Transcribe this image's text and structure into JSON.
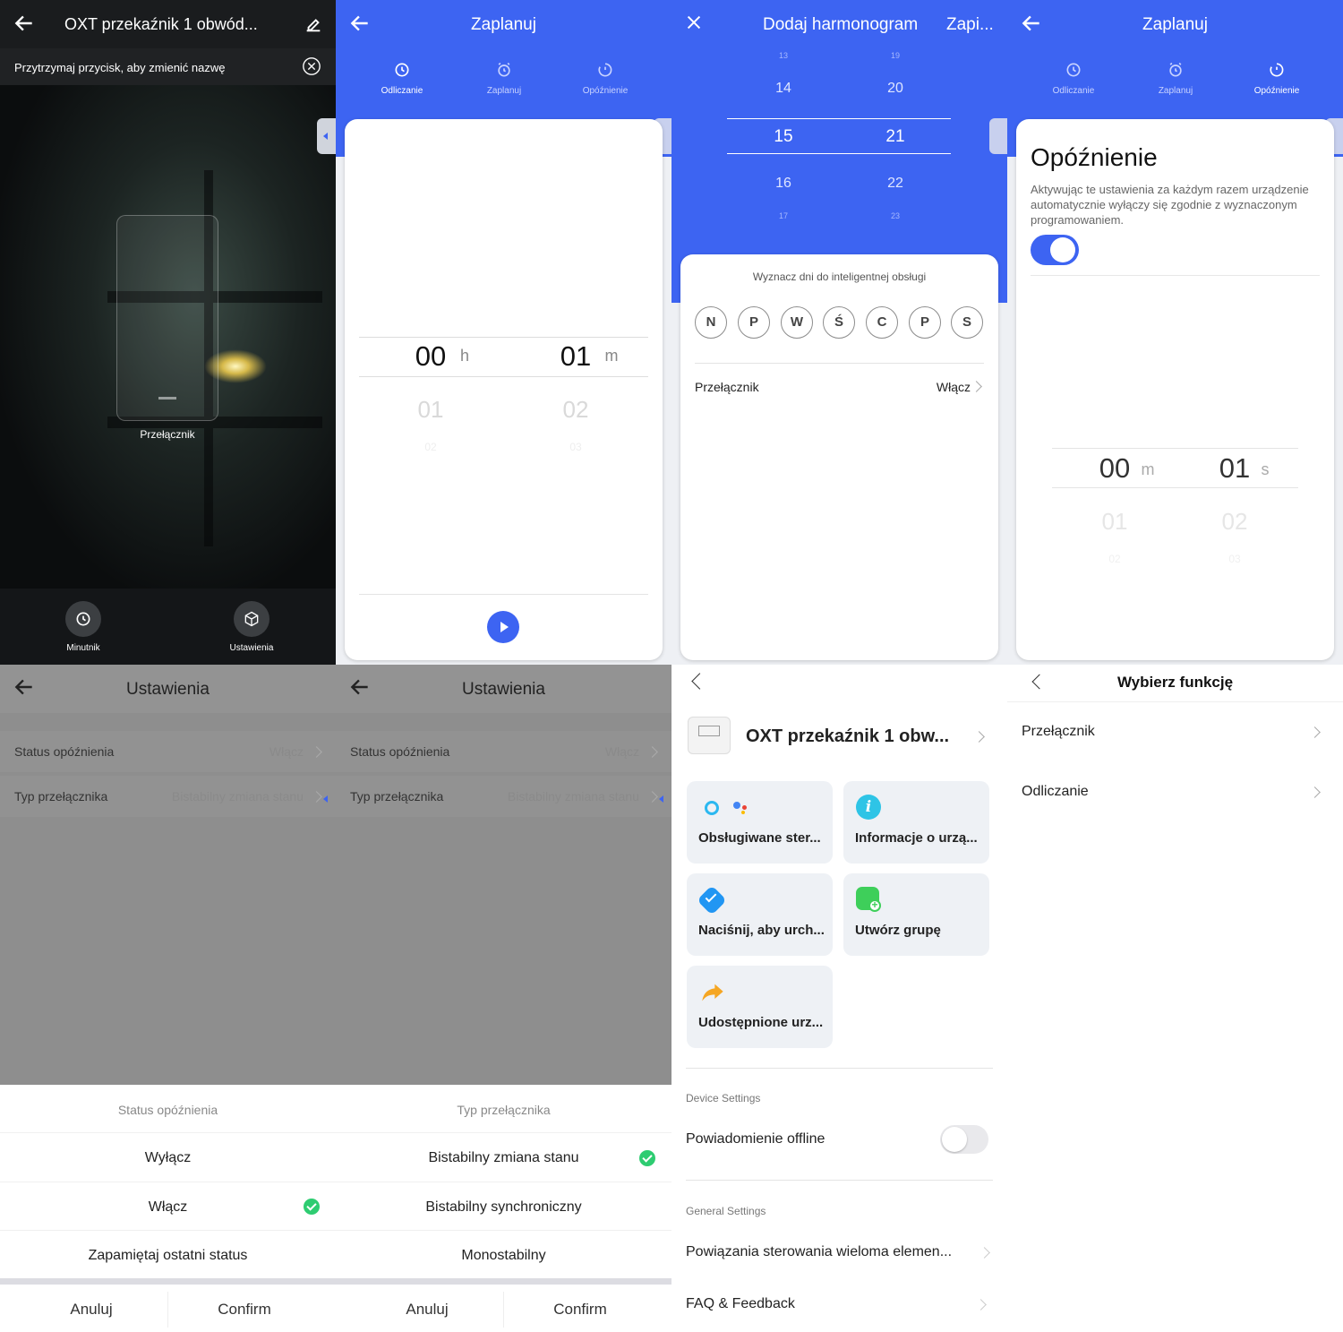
{
  "colors": {
    "primary": "#3d64f2",
    "check": "#2ecc71",
    "overlay": "#8e8e8e"
  },
  "p1": {
    "title": "OXT przekaźnik 1 obwód...",
    "hint": "Przytrzymaj przycisk, aby zmienić nazwę",
    "switch_label": "Przełącznik",
    "btn_timer": "Minutnik",
    "btn_settings": "Ustawienia"
  },
  "p2": {
    "title": "Zaplanuj",
    "tabs": [
      "Odliczanie",
      "Zaplanuj",
      "Opóźnienie"
    ],
    "picker": {
      "h": "00",
      "h_unit": "h",
      "m": "01",
      "m_unit": "m",
      "h_next": "01",
      "m_next": "02",
      "h_next2": "02",
      "m_next2": "03"
    }
  },
  "p3": {
    "title": "Dodaj harmonogram",
    "save": "Zapi...",
    "hours": [
      "13",
      "14",
      "15",
      "16",
      "17"
    ],
    "minutes": [
      "19",
      "20",
      "21",
      "22",
      "23"
    ],
    "days_label": "Wyznacz dni do inteligentnej obsługi",
    "days": [
      "N",
      "P",
      "W",
      "Ś",
      "C",
      "P",
      "S"
    ],
    "switch_label": "Przełącznik",
    "switch_value": "Włącz"
  },
  "p4": {
    "title": "Zaplanuj",
    "tabs": [
      "Odliczanie",
      "Zaplanuj",
      "Opóźnienie"
    ],
    "heading": "Opóźnienie",
    "desc": "Aktywując te ustawienia za każdym razem urządzenie automatycznie wyłączy się zgodnie z wyznaczonym programowaniem.",
    "picker": {
      "m": "00",
      "m_unit": "m",
      "s": "01",
      "s_unit": "s",
      "m_next": "01",
      "s_next": "02",
      "m_next2": "02",
      "s_next2": "03"
    }
  },
  "p5": {
    "title": "Ustawienia",
    "rows": [
      {
        "label": "Status opóźnienia",
        "value": "Włącz"
      },
      {
        "label": "Typ przełącznika",
        "value": "Bistabilny zmiana stanu"
      }
    ],
    "sheet_title": "Status opóźnienia",
    "options": [
      "Wyłącz",
      "Włącz",
      "Zapamiętaj ostatni status"
    ],
    "cancel": "Anuluj",
    "confirm": "Confirm"
  },
  "p6": {
    "title": "Ustawienia",
    "rows": [
      {
        "label": "Status opóźnienia",
        "value": "Włącz"
      },
      {
        "label": "Typ przełącznika",
        "value": "Bistabilny zmiana stanu"
      }
    ],
    "sheet_title": "Typ przełącznika",
    "options": [
      "Bistabilny zmiana stanu",
      "Bistabilny synchroniczny",
      "Monostabilny"
    ],
    "cancel": "Anuluj",
    "confirm": "Confirm"
  },
  "p7": {
    "device_name": "OXT przekaźnik 1 obw...",
    "tiles": [
      "Obsługiwane ster...",
      "Informacje o urzą...",
      "Naciśnij, aby urch...",
      "Utwórz grupę",
      "Udostępnione urz..."
    ],
    "device_settings": "Device Settings",
    "offline": "Powiadomienie offline",
    "general_settings": "General Settings",
    "multi": "Powiązania sterowania wieloma elemen...",
    "faq": "FAQ & Feedback"
  },
  "p8": {
    "title": "Wybierz funkcję",
    "items": [
      "Przełącznik",
      "Odliczanie"
    ]
  }
}
